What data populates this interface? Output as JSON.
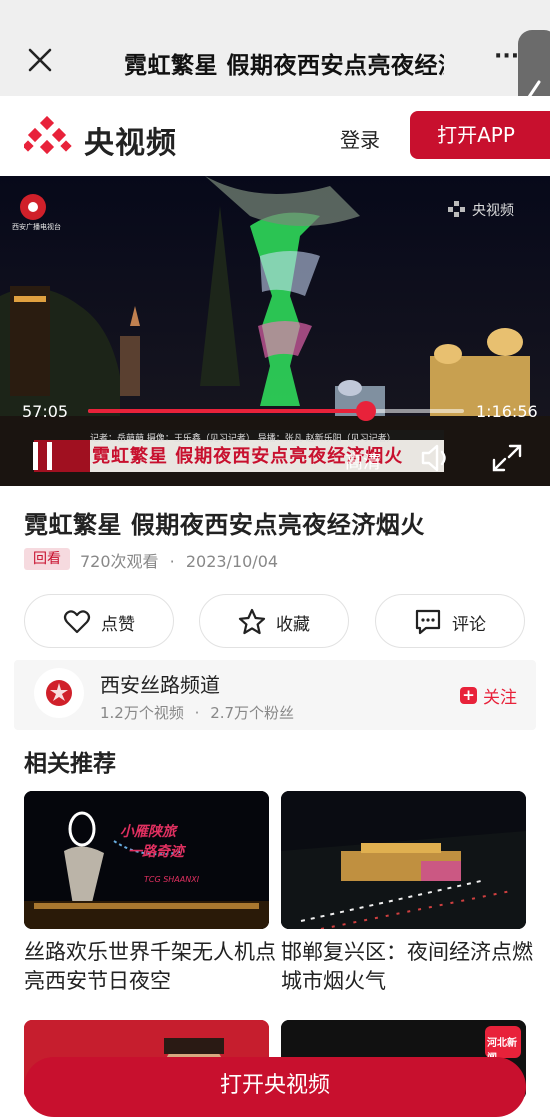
{
  "browser": {
    "title": "霓虹繁星 假期夜西安点亮夜经济烟火",
    "close_icon": "close-icon",
    "more_icon": "more-icon",
    "more_glyph": "···"
  },
  "header": {
    "brand": "央视频",
    "login": "登录",
    "open_app": "打开APP"
  },
  "player": {
    "watermark": "央视频",
    "current_time": "57:05",
    "duration": "1:16:56",
    "progress": 0.74,
    "caption_small": "记者：岳萌萌  摄像：王乐鑫（见习记者） 导播：张凡  赵新乐阳（见习记者）",
    "caption_main": "霓虹繁星 假期夜西安点亮夜经济烟火",
    "station": "西安广播电视台",
    "quality": "高清"
  },
  "video_info": {
    "title": "霓虹繁星 假期夜西安点亮夜经济烟火",
    "badge": "回看",
    "views": "720次观看",
    "dot": "·",
    "date": "2023/10/04"
  },
  "actions": {
    "like": "点赞",
    "favorite": "收藏",
    "comment": "评论"
  },
  "channel": {
    "name": "西安丝路频道",
    "videos": "1.2万个视频",
    "dot": "·",
    "fans": "2.7万个粉丝",
    "follow": "关注",
    "follow_plus": "+"
  },
  "related": {
    "heading": "相关推荐",
    "items": [
      {
        "title": "丝路欢乐世界千架无人机点亮西安节日夜空",
        "overlay_1": "小雁陕旅",
        "overlay_2": "一路奇迹",
        "overlay_3": "TCG SHAANXI"
      },
      {
        "title": "邯郸复兴区：夜间经济点燃城市烟火气"
      },
      {
        "title": ""
      },
      {
        "title": "",
        "logo_text": "河北新闻"
      }
    ]
  },
  "footer": {
    "open_cctv": "打开央视频"
  },
  "colors": {
    "accent": "#c8102e",
    "progress": "#e8223a"
  }
}
